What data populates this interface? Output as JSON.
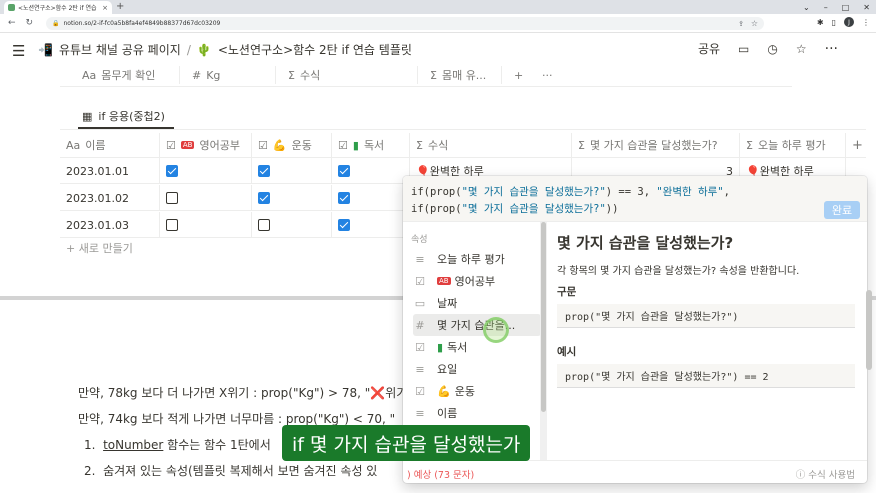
{
  "browser": {
    "tab_title": "<노션연구소>함수 2탄 if 연습 |",
    "url": "notion.so/2-if-fc0a5b8fa4ef4849b88377d67dc03209"
  },
  "topbar": {
    "breadcrumb": [
      "유튜브 채널 공유 페이지",
      "<노션연구소>함수 2탄 if 연습 템플릿"
    ],
    "share_label": "공유"
  },
  "table1": {
    "headers": [
      {
        "icon": "Aa",
        "label": "몸무게 확인"
      },
      {
        "icon": "#",
        "label": "Kg"
      },
      {
        "icon": "Σ",
        "label": "수식"
      },
      {
        "icon": "Σ",
        "label": "몸매 유..."
      }
    ]
  },
  "table2": {
    "title": "if 응용(중첩2)",
    "headers": [
      {
        "icon": "Aa",
        "label": "이름"
      },
      {
        "icon": "☑",
        "label": "영어공부"
      },
      {
        "icon": "☑",
        "label": "운동"
      },
      {
        "icon": "☑",
        "label": "독서"
      },
      {
        "icon": "Σ",
        "label": "수식"
      },
      {
        "icon": "Σ",
        "label": "몇 가지 습관을 달성했는가?"
      },
      {
        "icon": "Σ",
        "label": "오늘 하루 평가"
      }
    ],
    "rows": [
      {
        "name": "2023.01.01",
        "english": true,
        "exercise": true,
        "reading": true,
        "formula": "완벽한 하루",
        "count": "3",
        "eval": "완벽한 하루"
      },
      {
        "name": "2023.01.02",
        "english": false,
        "exercise": true,
        "reading": true,
        "formula": "",
        "count": "",
        "eval": ""
      },
      {
        "name": "2023.01.03",
        "english": false,
        "exercise": false,
        "reading": true,
        "formula": "",
        "count": "",
        "eval": ""
      }
    ],
    "new_row": "+ 새로 만들기"
  },
  "body": {
    "line1": "만약, 78kg 보다 더 나가면 X위기 : prop(\"Kg\") > 78, \"❌위기",
    "line2": "만약, 74kg 보다 적게 나가면 너무마름 : prop(\"Kg\") < 70, \"",
    "list1_a": "toNumber",
    "list1_b": " 함수는 함수 1탄에서",
    "list2": "숨겨져 있는 속성(템플릿 복제해서 보면 숨겨진 속성 있"
  },
  "popup": {
    "code_line1_a": "if(prop(",
    "code_line1_s": "\"몇 가지 습관을 달성했는가?\"",
    "code_line1_b": ") == 3, ",
    "code_line1_s2": "\"완벽한 하루\"",
    "code_line1_c": ",",
    "code_line2_a": "if(prop(",
    "code_line2_s": "\"몇 가지 습관을 달성했는가?\"",
    "code_line2_b": "))",
    "done_label": "완료",
    "section_label": "속성",
    "properties": [
      {
        "icon": "≡",
        "label": "오늘 하루 평가"
      },
      {
        "icon": "☑",
        "label": "영어공부"
      },
      {
        "icon": "▭",
        "label": "날짜"
      },
      {
        "icon": "#",
        "label": "몇 가지 습관을..."
      },
      {
        "icon": "☑",
        "label": "독서"
      },
      {
        "icon": "≡",
        "label": "요일"
      },
      {
        "icon": "☑",
        "label": "운동"
      },
      {
        "icon": "≡",
        "label": "이름"
      }
    ],
    "detail_title": "몇 가지 습관을 달성했는가?",
    "detail_desc": "각 항목의 몇 가지 습관을 달성했는가? 속성을 반환합니다.",
    "syntax_label": "구문",
    "syntax_code": "prop(\"몇 가지 습관을 달성했는가?\")",
    "example_label": "예시",
    "example_code": "prop(\"몇 가지 습관을 달성했는가?\") == 2",
    "footer_left": ") 예상 (73 문자)",
    "footer_right": "ⓘ 수식 사용법"
  },
  "subtitle": "if 몇 가지 습관을 달성했는가"
}
